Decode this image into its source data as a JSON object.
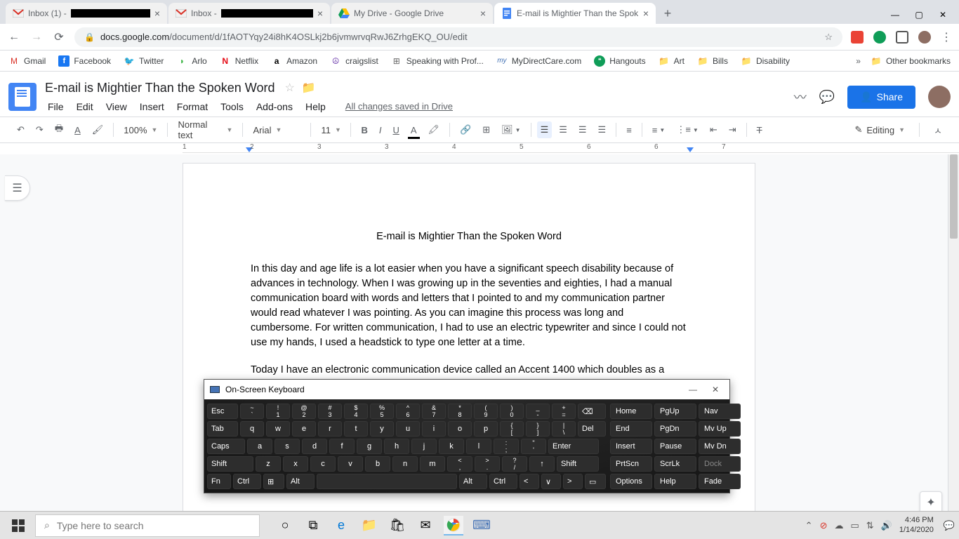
{
  "browser": {
    "tabs": [
      {
        "favicon": "gmail",
        "prefix": "Inbox (1) - ",
        "redacted": true,
        "active": false
      },
      {
        "favicon": "gmail",
        "prefix": "Inbox - ",
        "redacted": true,
        "active": false
      },
      {
        "favicon": "gdrive",
        "title": "My Drive - Google Drive",
        "active": false
      },
      {
        "favicon": "gdocs",
        "title": "E-mail is Mightier Than the Spok",
        "active": true
      }
    ],
    "url_domain": "docs.google.com",
    "url_path": "/document/d/1fAOTYqy24i8hK4OSLkj2b6jvmwrvqRwJ6ZrhgEKQ_OU/edit"
  },
  "bookmarks": [
    {
      "icon": "gmail",
      "label": "Gmail"
    },
    {
      "icon": "fb",
      "label": "Facebook"
    },
    {
      "icon": "tw",
      "label": "Twitter"
    },
    {
      "icon": "arlo",
      "label": "Arlo"
    },
    {
      "icon": "netflix",
      "label": "Netflix"
    },
    {
      "icon": "amazon",
      "label": "Amazon"
    },
    {
      "icon": "cl",
      "label": "craigslist"
    },
    {
      "icon": "cal",
      "label": "Speaking with Prof..."
    },
    {
      "icon": "mdc",
      "label": "MyDirectCare.com"
    },
    {
      "icon": "ho",
      "label": "Hangouts"
    },
    {
      "icon": "folder",
      "label": "Art"
    },
    {
      "icon": "folder",
      "label": "Bills"
    },
    {
      "icon": "folder",
      "label": "Disability"
    }
  ],
  "bookmarks_right": "Other bookmarks",
  "docs": {
    "title": "E-mail is Mightier Than the Spoken Word",
    "menus": [
      "File",
      "Edit",
      "View",
      "Insert",
      "Format",
      "Tools",
      "Add-ons",
      "Help"
    ],
    "save_status": "All changes saved in Drive",
    "share_label": "Share",
    "toolbar": {
      "zoom": "100%",
      "style": "Normal text",
      "font": "Arial",
      "size": "11",
      "mode": "Editing"
    }
  },
  "document": {
    "heading": "E-mail is Mightier Than the Spoken Word",
    "para1": "In this day and age life is a lot easier when you have a significant speech disability because of advances in technology.  When I was growing up in the seventies and eighties, I had a manual communication board with words and letters that I pointed to and my communication partner would read whatever I was pointing.  As you can imagine this process was long and cumbersome.  For written communication, I had to use an electric typewriter and since I could not use my hands, I used a headstick to type one letter at a time.",
    "para2": "Today I have an electronic communication device called an Accent 1400 which doubles as a"
  },
  "osk": {
    "title": "On-Screen Keyboard",
    "row1": [
      "Esc",
      "~ `",
      "! 1",
      "@ 2",
      "# 3",
      "$ 4",
      "% 5",
      "^ 6",
      "& 7",
      "* 8",
      "( 9",
      ") 0",
      "_ -",
      "+ =",
      "⌫"
    ],
    "row2": [
      "Tab",
      "q",
      "w",
      "e",
      "r",
      "t",
      "y",
      "u",
      "i",
      "o",
      "p",
      "{ [",
      "} ]",
      "| \\",
      "Del"
    ],
    "row3": [
      "Caps",
      "a",
      "s",
      "d",
      "f",
      "g",
      "h",
      "j",
      "k",
      "l",
      ": ;",
      "\" '",
      "Enter"
    ],
    "row4": [
      "Shift",
      "z",
      "x",
      "c",
      "v",
      "b",
      "n",
      "m",
      "< ,",
      "> .",
      "? /",
      "↑",
      "Shift"
    ],
    "row5": [
      "Fn",
      "Ctrl",
      "⊞",
      "Alt",
      "",
      "Alt",
      "Ctrl",
      "<",
      "∨",
      ">",
      "▭"
    ],
    "side1": [
      "Home",
      "PgUp",
      "Nav"
    ],
    "side2": [
      "End",
      "PgDn",
      "Mv Up"
    ],
    "side3": [
      "Insert",
      "Pause",
      "Mv Dn"
    ],
    "side4": [
      "PrtScn",
      "ScrLk",
      "Dock"
    ],
    "side5": [
      "Options",
      "Help",
      "Fade"
    ]
  },
  "taskbar": {
    "search_placeholder": "Type here to search",
    "time": "4:46 PM",
    "date": "1/14/2020"
  }
}
